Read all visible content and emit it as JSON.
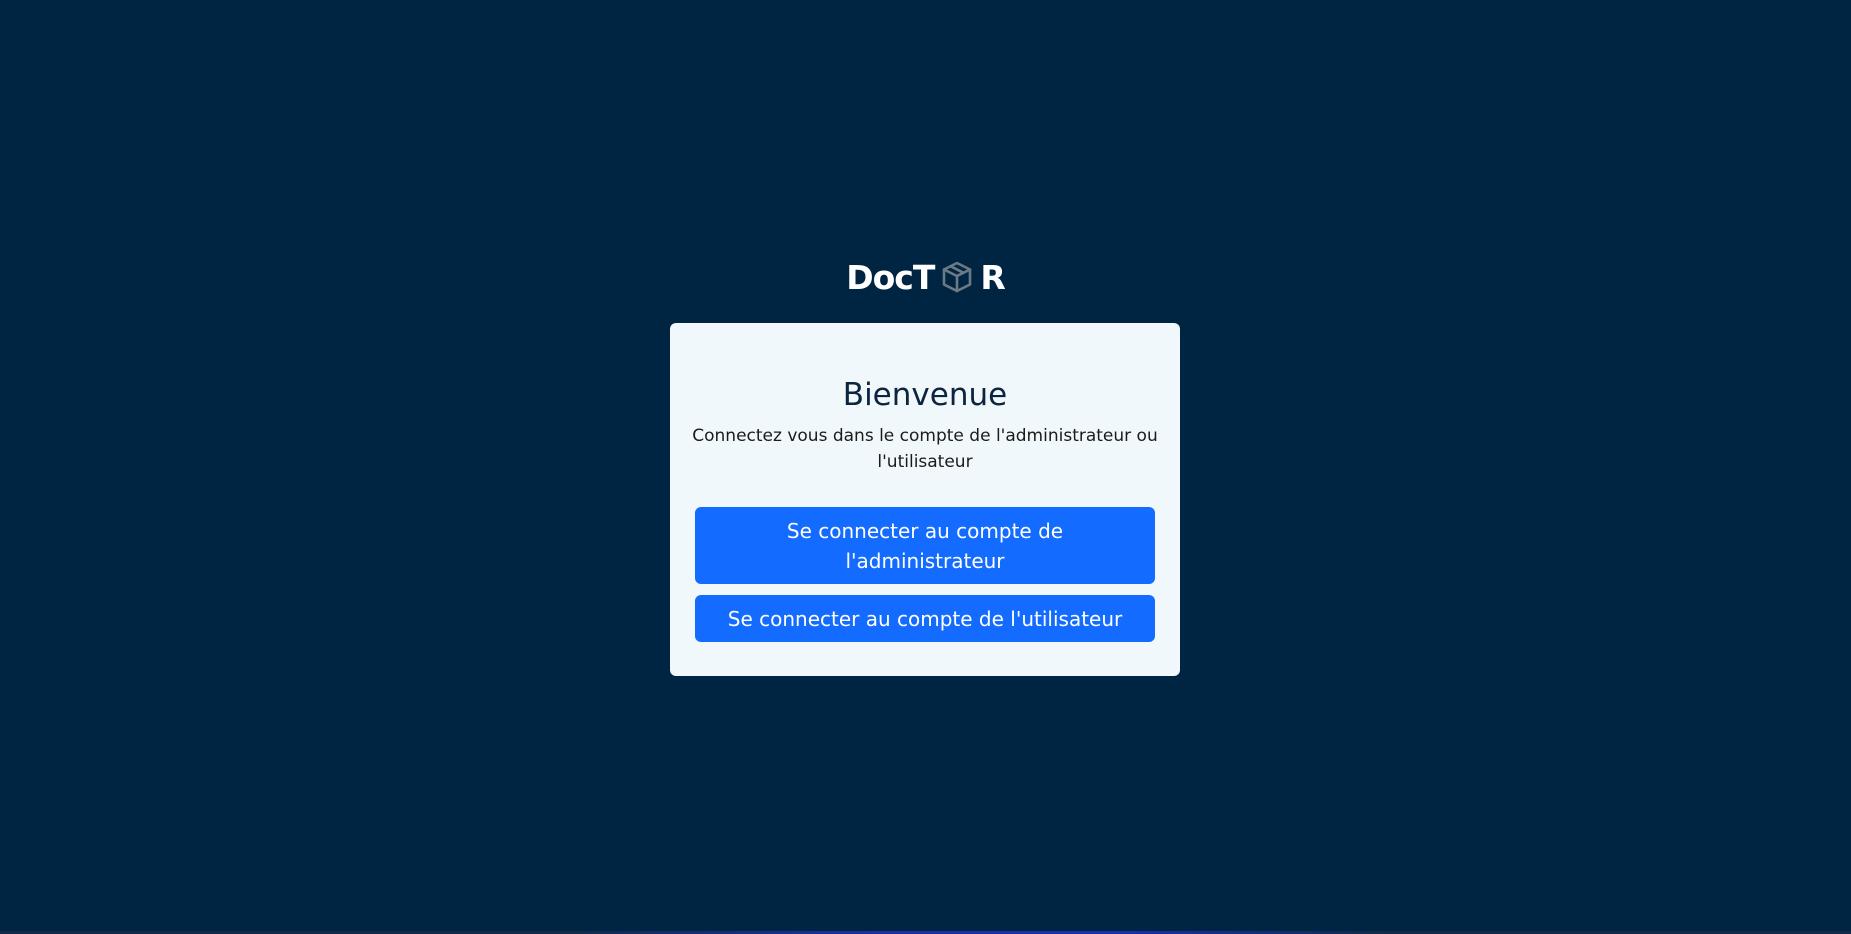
{
  "logo": {
    "text_before": "DocT",
    "icon": "cube-icon",
    "text_after": "R"
  },
  "card": {
    "title": "Bienvenue",
    "subtitle": "Connectez vous dans le compte de l'administrateur ou l'utilisateur",
    "admin_button_label": "Se connecter au compte de l'administrateur",
    "user_button_label": "Se connecter au compte de l'utilisateur"
  },
  "colors": {
    "background": "#002542",
    "card_background": "#f0f8fb",
    "button": "#136cff",
    "title": "#0b2440"
  }
}
